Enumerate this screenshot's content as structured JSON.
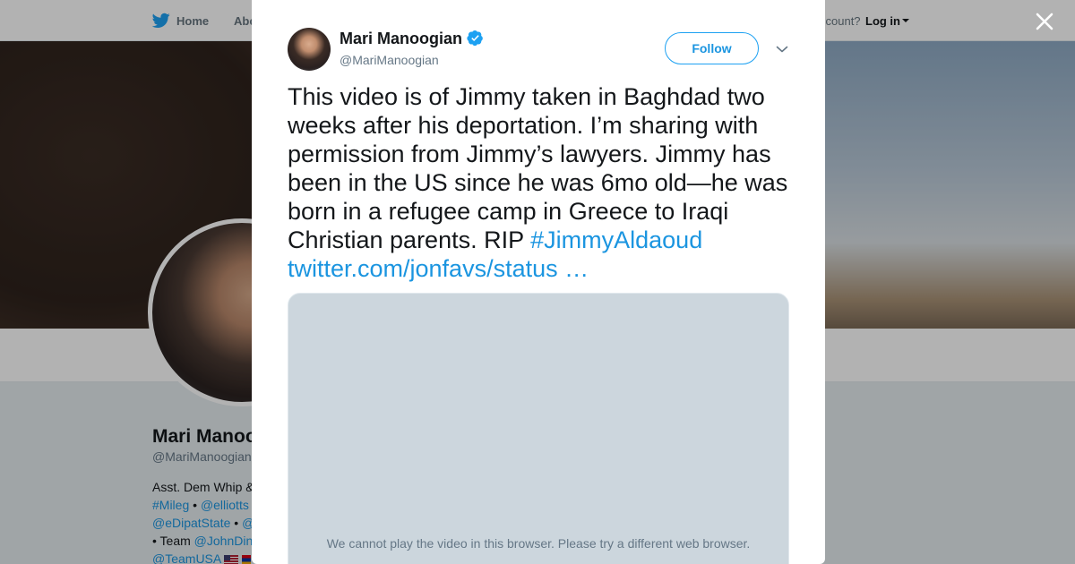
{
  "topnav": {
    "home_label": "Home",
    "about_label": "Abo",
    "account_prompt": "ccount?",
    "login_label": "Log in"
  },
  "profile": {
    "name": "Mari Manoog",
    "handle": "@MariManoogian",
    "bio_lines": {
      "line1": "Asst. Dem Whip &",
      "line2_tag": "#Mileg",
      "line2_sep": " • ",
      "line2_mention": "@elliotts",
      "line3_mention": "@eDipatState",
      "line3_sep": " • ",
      "line3_tail": "@",
      "line4_prefix": "• Team ",
      "line4_mention": "@JohnDin",
      "line5_mention": "@TeamUSA"
    }
  },
  "tweet": {
    "author_name": "Mari Manoogian",
    "author_handle": "@MariManoogian",
    "follow_label": "Follow",
    "text": "This video is of Jimmy taken in Baghdad two weeks after his deportation. I’m sharing with permission from Jimmy’s lawyers. Jimmy has been in the US since he was 6mo old—he was born in a refugee camp in Greece to Iraqi Christian parents. RIP ",
    "hashtag": "#JimmyAldaoud",
    "link": "twitter.com/jonfavs/status …",
    "video_message": "We cannot play the video in this browser. Please try a different web browser."
  },
  "colors": {
    "accent": "#1da1f2",
    "link": "#1b95e0",
    "video_placeholder": "#ccd6dd"
  },
  "icons": {
    "nav_logo": "twitter-bird-icon",
    "verified": "verified-badge-icon",
    "more": "chevron-down-icon",
    "close": "close-icon"
  }
}
